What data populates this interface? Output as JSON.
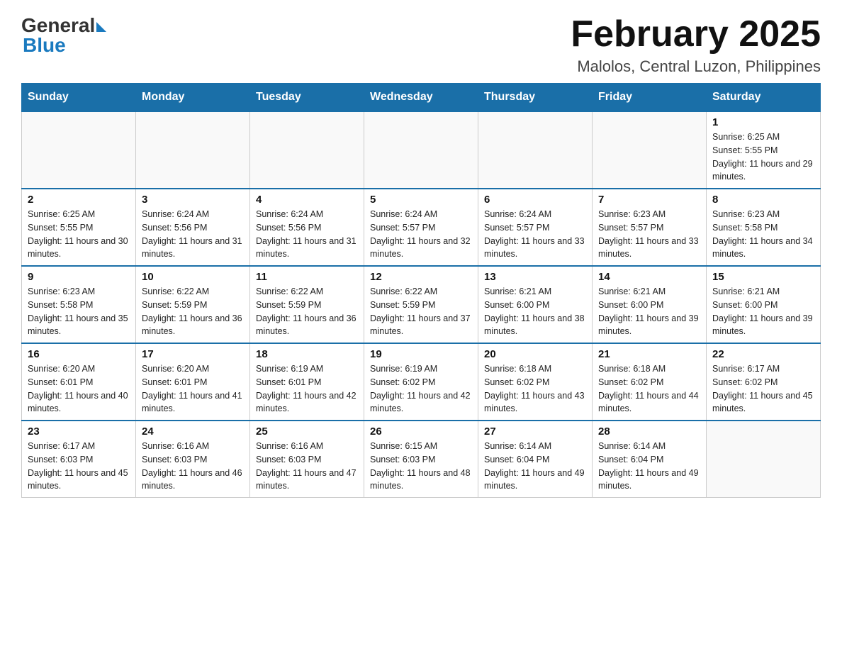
{
  "logo": {
    "general": "General",
    "blue": "Blue"
  },
  "header": {
    "month_year": "February 2025",
    "location": "Malolos, Central Luzon, Philippines"
  },
  "weekdays": [
    "Sunday",
    "Monday",
    "Tuesday",
    "Wednesday",
    "Thursday",
    "Friday",
    "Saturday"
  ],
  "weeks": [
    [
      {
        "day": "",
        "info": ""
      },
      {
        "day": "",
        "info": ""
      },
      {
        "day": "",
        "info": ""
      },
      {
        "day": "",
        "info": ""
      },
      {
        "day": "",
        "info": ""
      },
      {
        "day": "",
        "info": ""
      },
      {
        "day": "1",
        "info": "Sunrise: 6:25 AM\nSunset: 5:55 PM\nDaylight: 11 hours and 29 minutes."
      }
    ],
    [
      {
        "day": "2",
        "info": "Sunrise: 6:25 AM\nSunset: 5:55 PM\nDaylight: 11 hours and 30 minutes."
      },
      {
        "day": "3",
        "info": "Sunrise: 6:24 AM\nSunset: 5:56 PM\nDaylight: 11 hours and 31 minutes."
      },
      {
        "day": "4",
        "info": "Sunrise: 6:24 AM\nSunset: 5:56 PM\nDaylight: 11 hours and 31 minutes."
      },
      {
        "day": "5",
        "info": "Sunrise: 6:24 AM\nSunset: 5:57 PM\nDaylight: 11 hours and 32 minutes."
      },
      {
        "day": "6",
        "info": "Sunrise: 6:24 AM\nSunset: 5:57 PM\nDaylight: 11 hours and 33 minutes."
      },
      {
        "day": "7",
        "info": "Sunrise: 6:23 AM\nSunset: 5:57 PM\nDaylight: 11 hours and 33 minutes."
      },
      {
        "day": "8",
        "info": "Sunrise: 6:23 AM\nSunset: 5:58 PM\nDaylight: 11 hours and 34 minutes."
      }
    ],
    [
      {
        "day": "9",
        "info": "Sunrise: 6:23 AM\nSunset: 5:58 PM\nDaylight: 11 hours and 35 minutes."
      },
      {
        "day": "10",
        "info": "Sunrise: 6:22 AM\nSunset: 5:59 PM\nDaylight: 11 hours and 36 minutes."
      },
      {
        "day": "11",
        "info": "Sunrise: 6:22 AM\nSunset: 5:59 PM\nDaylight: 11 hours and 36 minutes."
      },
      {
        "day": "12",
        "info": "Sunrise: 6:22 AM\nSunset: 5:59 PM\nDaylight: 11 hours and 37 minutes."
      },
      {
        "day": "13",
        "info": "Sunrise: 6:21 AM\nSunset: 6:00 PM\nDaylight: 11 hours and 38 minutes."
      },
      {
        "day": "14",
        "info": "Sunrise: 6:21 AM\nSunset: 6:00 PM\nDaylight: 11 hours and 39 minutes."
      },
      {
        "day": "15",
        "info": "Sunrise: 6:21 AM\nSunset: 6:00 PM\nDaylight: 11 hours and 39 minutes."
      }
    ],
    [
      {
        "day": "16",
        "info": "Sunrise: 6:20 AM\nSunset: 6:01 PM\nDaylight: 11 hours and 40 minutes."
      },
      {
        "day": "17",
        "info": "Sunrise: 6:20 AM\nSunset: 6:01 PM\nDaylight: 11 hours and 41 minutes."
      },
      {
        "day": "18",
        "info": "Sunrise: 6:19 AM\nSunset: 6:01 PM\nDaylight: 11 hours and 42 minutes."
      },
      {
        "day": "19",
        "info": "Sunrise: 6:19 AM\nSunset: 6:02 PM\nDaylight: 11 hours and 42 minutes."
      },
      {
        "day": "20",
        "info": "Sunrise: 6:18 AM\nSunset: 6:02 PM\nDaylight: 11 hours and 43 minutes."
      },
      {
        "day": "21",
        "info": "Sunrise: 6:18 AM\nSunset: 6:02 PM\nDaylight: 11 hours and 44 minutes."
      },
      {
        "day": "22",
        "info": "Sunrise: 6:17 AM\nSunset: 6:02 PM\nDaylight: 11 hours and 45 minutes."
      }
    ],
    [
      {
        "day": "23",
        "info": "Sunrise: 6:17 AM\nSunset: 6:03 PM\nDaylight: 11 hours and 45 minutes."
      },
      {
        "day": "24",
        "info": "Sunrise: 6:16 AM\nSunset: 6:03 PM\nDaylight: 11 hours and 46 minutes."
      },
      {
        "day": "25",
        "info": "Sunrise: 6:16 AM\nSunset: 6:03 PM\nDaylight: 11 hours and 47 minutes."
      },
      {
        "day": "26",
        "info": "Sunrise: 6:15 AM\nSunset: 6:03 PM\nDaylight: 11 hours and 48 minutes."
      },
      {
        "day": "27",
        "info": "Sunrise: 6:14 AM\nSunset: 6:04 PM\nDaylight: 11 hours and 49 minutes."
      },
      {
        "day": "28",
        "info": "Sunrise: 6:14 AM\nSunset: 6:04 PM\nDaylight: 11 hours and 49 minutes."
      },
      {
        "day": "",
        "info": ""
      }
    ]
  ]
}
